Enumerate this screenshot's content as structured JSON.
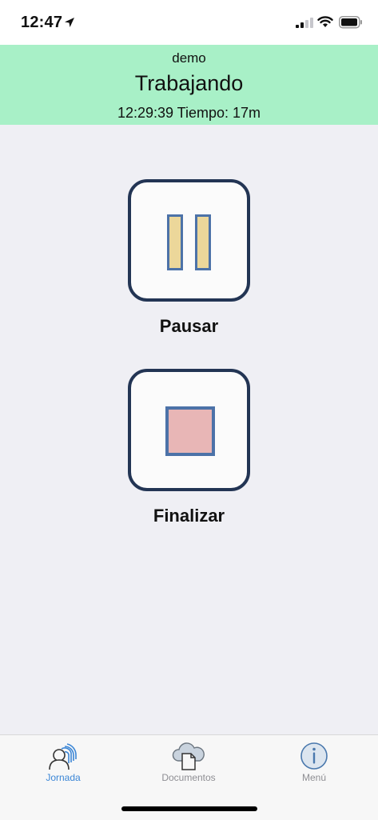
{
  "status": {
    "time": "12:47"
  },
  "header": {
    "user": "demo",
    "state": "Trabajando",
    "time_info": "12:29:39 Tiempo: 17m",
    "background": "#a8f0c7"
  },
  "actions": {
    "pause_label": "Pausar",
    "finish_label": "Finalizar"
  },
  "tabbar": {
    "items": [
      {
        "label": "Jornada",
        "icon": "fingerprint-user-icon",
        "active": true,
        "color": "#3b86d6"
      },
      {
        "label": "Documentos",
        "icon": "cloud-document-icon",
        "active": false,
        "color": "#8e8e93"
      },
      {
        "label": "Menú",
        "icon": "info-icon",
        "active": false,
        "color": "#8e8e93"
      }
    ]
  }
}
